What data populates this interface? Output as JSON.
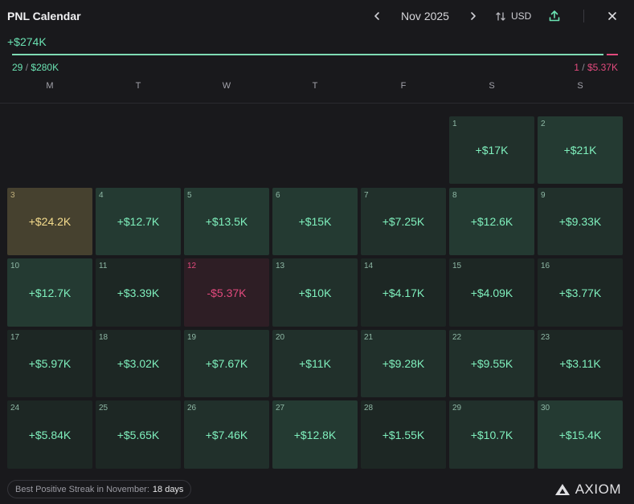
{
  "header": {
    "title": "PNL Calendar",
    "month": "Nov 2025",
    "currency": "USD"
  },
  "summary": {
    "total": "+$274K",
    "positive_days": "29",
    "positive_total": "$280K",
    "negative_days": "1",
    "negative_total": "$5.37K",
    "separator": "/"
  },
  "weekdays": [
    "M",
    "T",
    "W",
    "T",
    "F",
    "S",
    "S"
  ],
  "colors": {
    "positive": "#6be3b3",
    "negative": "#e24a7d",
    "best_day": "#f5dc8d",
    "background": "#19191c"
  },
  "days": [
    {
      "day": "1",
      "value": "+$17K",
      "tone": "c2"
    },
    {
      "day": "2",
      "value": "+$21K",
      "tone": "c1"
    },
    {
      "day": "3",
      "value": "+$24.2K",
      "tone": "gold"
    },
    {
      "day": "4",
      "value": "+$12.7K",
      "tone": "c1"
    },
    {
      "day": "5",
      "value": "+$13.5K",
      "tone": "c1"
    },
    {
      "day": "6",
      "value": "+$15K",
      "tone": "c1"
    },
    {
      "day": "7",
      "value": "+$7.25K",
      "tone": "c2"
    },
    {
      "day": "8",
      "value": "+$12.6K",
      "tone": "c1"
    },
    {
      "day": "9",
      "value": "+$9.33K",
      "tone": "c2"
    },
    {
      "day": "10",
      "value": "+$12.7K",
      "tone": "c1"
    },
    {
      "day": "11",
      "value": "+$3.39K",
      "tone": "c3"
    },
    {
      "day": "12",
      "value": "-$5.37K",
      "tone": "neg"
    },
    {
      "day": "13",
      "value": "+$10K",
      "tone": "c2"
    },
    {
      "day": "14",
      "value": "+$4.17K",
      "tone": "c3"
    },
    {
      "day": "15",
      "value": "+$4.09K",
      "tone": "c3"
    },
    {
      "day": "16",
      "value": "+$3.77K",
      "tone": "c3"
    },
    {
      "day": "17",
      "value": "+$5.97K",
      "tone": "c3"
    },
    {
      "day": "18",
      "value": "+$3.02K",
      "tone": "c3"
    },
    {
      "day": "19",
      "value": "+$7.67K",
      "tone": "c2"
    },
    {
      "day": "20",
      "value": "+$11K",
      "tone": "c2"
    },
    {
      "day": "21",
      "value": "+$9.28K",
      "tone": "c2"
    },
    {
      "day": "22",
      "value": "+$9.55K",
      "tone": "c2"
    },
    {
      "day": "23",
      "value": "+$3.11K",
      "tone": "c3"
    },
    {
      "day": "24",
      "value": "+$5.84K",
      "tone": "c3"
    },
    {
      "day": "25",
      "value": "+$5.65K",
      "tone": "c3"
    },
    {
      "day": "26",
      "value": "+$7.46K",
      "tone": "c2"
    },
    {
      "day": "27",
      "value": "+$12.8K",
      "tone": "c1"
    },
    {
      "day": "28",
      "value": "+$1.55K",
      "tone": "c3"
    },
    {
      "day": "29",
      "value": "+$10.7K",
      "tone": "c2"
    },
    {
      "day": "30",
      "value": "+$15.4K",
      "tone": "c1"
    }
  ],
  "footer": {
    "streak_label": "Best Positive Streak in November:",
    "streak_value": "18 days",
    "brand": "AXIOM"
  }
}
